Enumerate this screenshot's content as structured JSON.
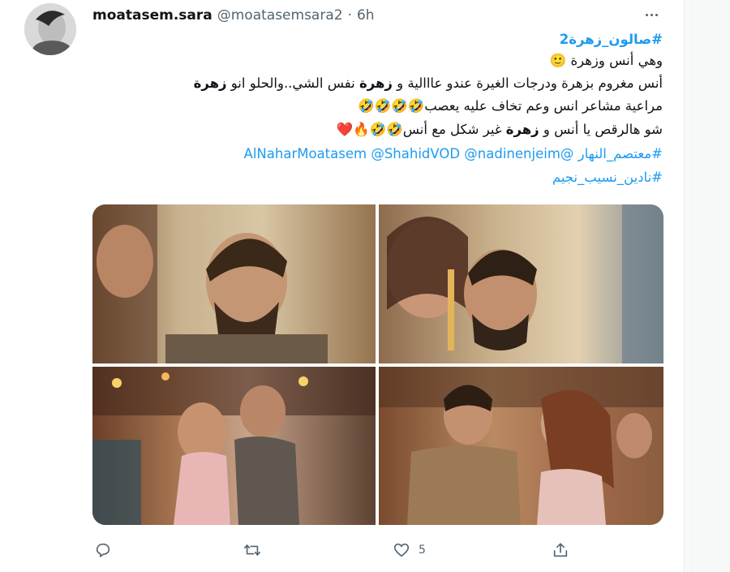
{
  "tweet": {
    "author_name": "moatasem.sara",
    "author_handle": "@moatasemsara2",
    "separator": "·",
    "time": "6h",
    "lines": {
      "line1": "#صالون_زهرة2",
      "line2_text": "وهي أنس وزهرة ",
      "line2_emoji": "🙂",
      "line3_a": "أنس مغروم بزهرة ودرجات الغيرة عندو عااالية و ",
      "line3_b": "زهرة",
      "line3_c": " نفس الشي..والحلو انو ",
      "line3_d": "زهرة",
      "line4_text": "مراعية مشاعر انس وعم تخاف عليه يعصب",
      "line4_emoji": "🤣🤣🤣🤣",
      "line5_a": "شو هالرقص يا أنس و ",
      "line5_b": "زهرة",
      "line5_c": " غير شكل مع أنس",
      "line5_emoji": "🤣🤣🔥❤️",
      "line6": "#معتصم_النهار @AlNaharMoatasem @ShahidVOD @nadinenjeim",
      "line7": "#نادين_نسيب_نجيم"
    },
    "actions": {
      "reply_count": "",
      "retweet_count": "",
      "like_count": "5",
      "share_label": ""
    }
  },
  "icons": {
    "more": "more-horizontal-icon",
    "reply": "reply-icon",
    "retweet": "retweet-icon",
    "like": "heart-icon",
    "share": "share-icon"
  },
  "colors": {
    "link": "#1d9bf0",
    "secondary": "#536471",
    "text": "#0f1419"
  }
}
